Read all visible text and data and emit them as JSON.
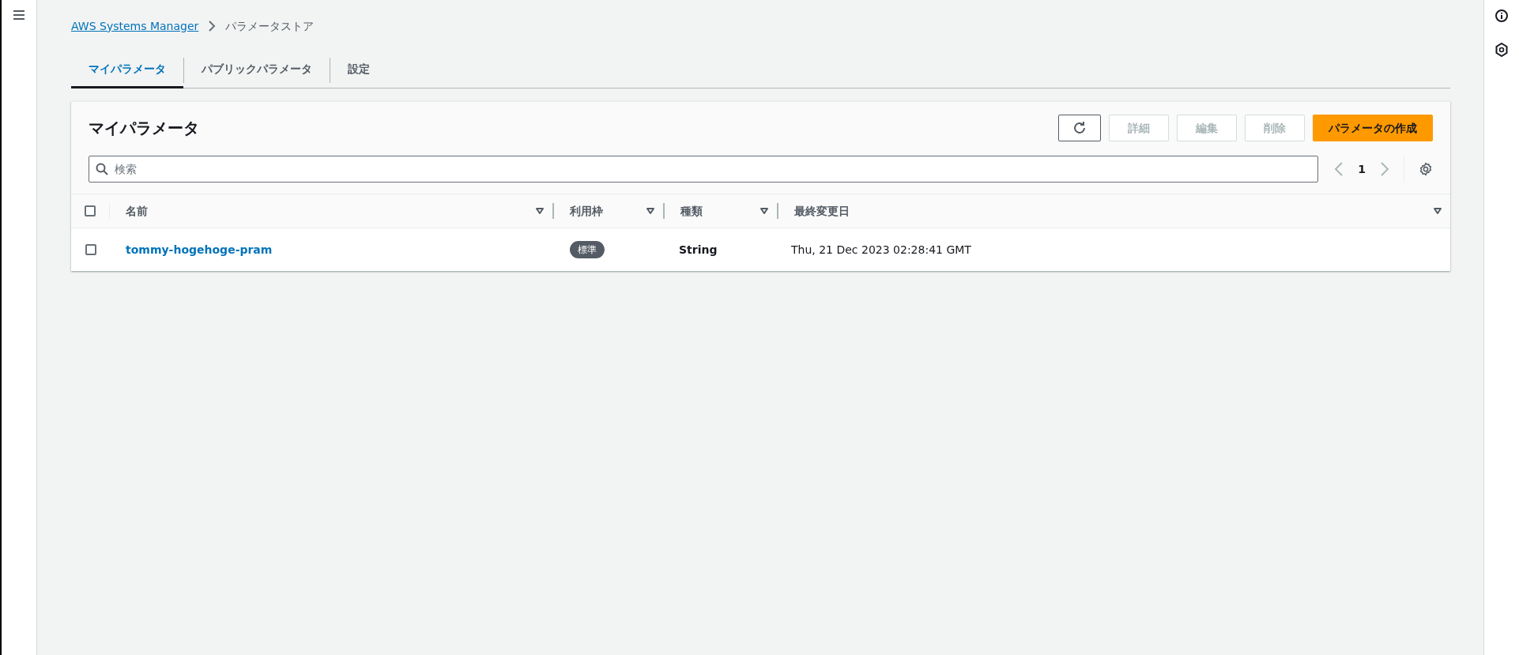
{
  "breadcrumb": [
    {
      "label": "AWS Systems Manager",
      "kind": "link"
    },
    {
      "label": "パラメータストア",
      "kind": "current"
    }
  ],
  "tabs": [
    {
      "label": "マイパラメータ",
      "selected": true
    },
    {
      "label": "パブリックパラメータ",
      "selected": false
    },
    {
      "label": "設定",
      "selected": false
    }
  ],
  "panel": {
    "title": "マイパラメータ",
    "buttons": [
      {
        "kind": "refresh",
        "disabled": false
      },
      {
        "kind": "text",
        "label": "詳細",
        "disabled": true
      },
      {
        "kind": "text",
        "label": "編集",
        "disabled": true
      },
      {
        "kind": "text",
        "label": "削除",
        "disabled": true
      },
      {
        "kind": "primary",
        "label": "パラメータの作成",
        "disabled": false
      }
    ],
    "search": {
      "placeholder": "検索"
    },
    "pagination": {
      "page": "1",
      "prev_disabled": true,
      "next_disabled": true
    },
    "table": {
      "select_all_checked": false,
      "columns": [
        {
          "label": "名前"
        },
        {
          "label": "利用枠"
        },
        {
          "label": "種類"
        },
        {
          "label": "最終変更日"
        }
      ],
      "rows": [
        {
          "checked": false,
          "name": "tommy-hogehoge-pram",
          "tier": "標準",
          "type": "String",
          "modified": "Thu, 21 Dec 2023 02:28:41 GMT"
        }
      ]
    }
  }
}
